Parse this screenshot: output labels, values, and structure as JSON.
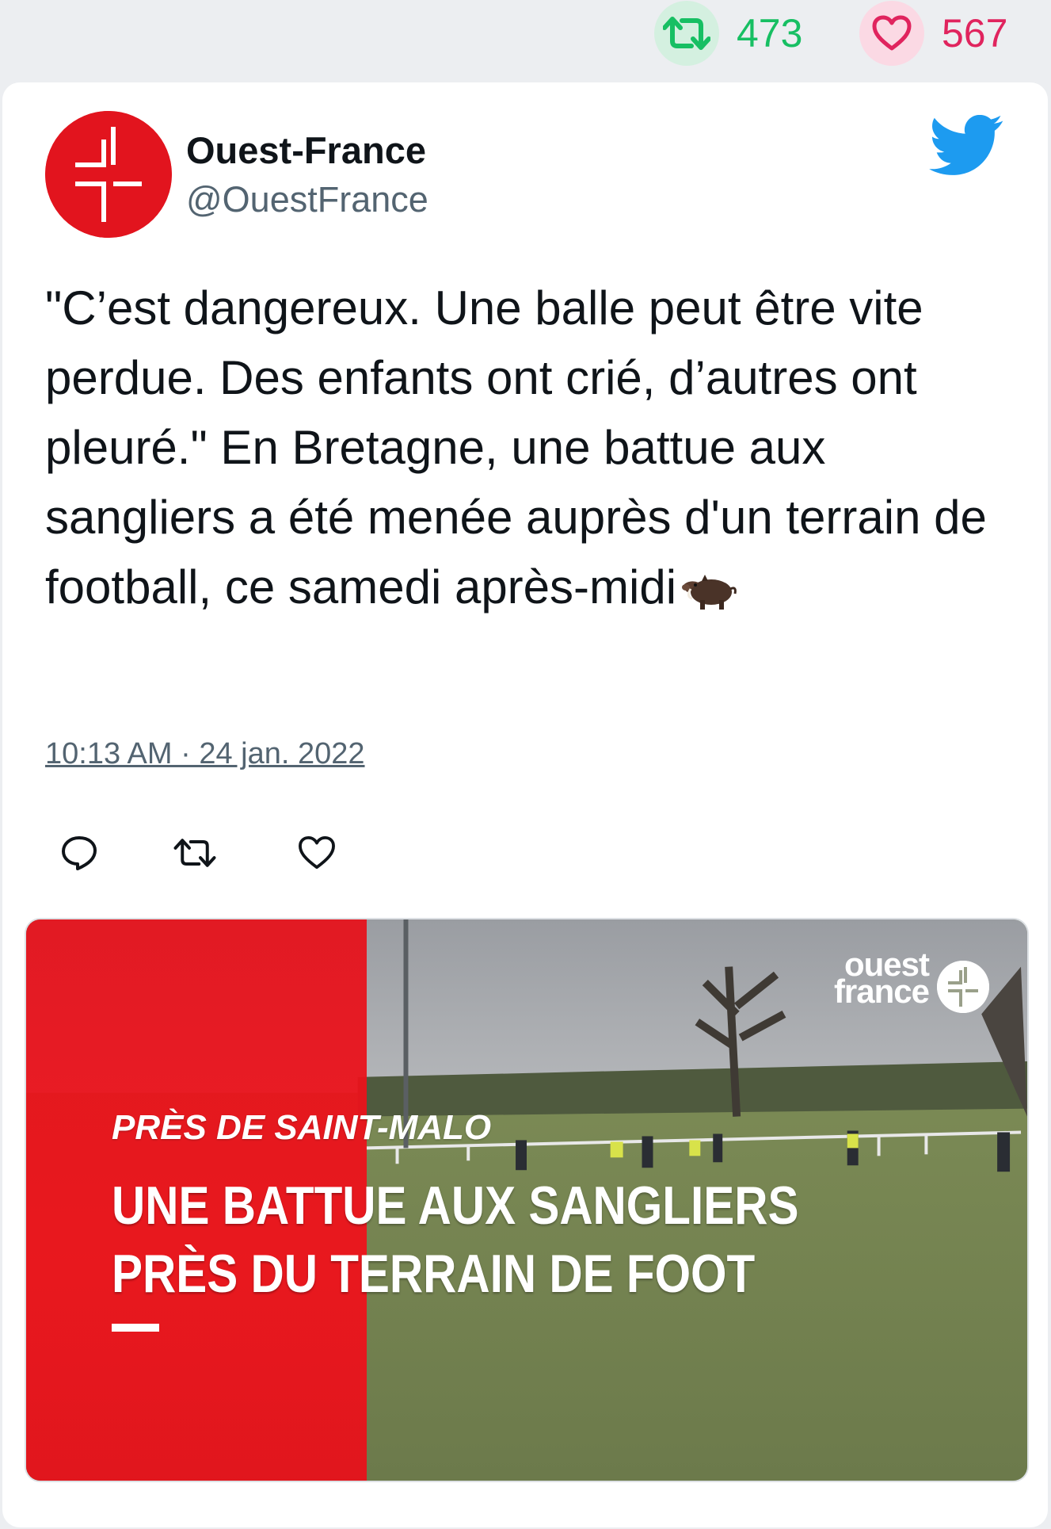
{
  "stats": {
    "retweet_count": "473",
    "like_count": "567"
  },
  "author": {
    "display_name": "Ouest-France",
    "handle": "@OuestFrance"
  },
  "tweet": {
    "text": "\"C’est dangereux. Une balle peut être vite perdue. Des enfants ont crié, d’autres ont pleuré.\" En Bretagne, une battue aux sangliers a été menée auprès d'un terrain de football, ce samedi après-midi",
    "emoji": "boar",
    "timestamp": "10:13 AM · 24 jan. 2022"
  },
  "media": {
    "logo_line1": "ouest",
    "logo_line2": "france",
    "kicker": "PRÈS DE SAINT-MALO",
    "headline_line1": "UNE BATTUE AUX SANGLIERS",
    "headline_line2": "PRÈS DU TERRAIN DE FOOT"
  },
  "icons": {
    "retweet": "retweet-icon",
    "like": "heart-icon",
    "reply": "reply-icon",
    "platform": "twitter-bird-icon"
  },
  "colors": {
    "retweet_green": "#17bf63",
    "like_pink": "#e0245e",
    "twitter_blue": "#1d9bf0",
    "brand_red": "#e2141e"
  }
}
